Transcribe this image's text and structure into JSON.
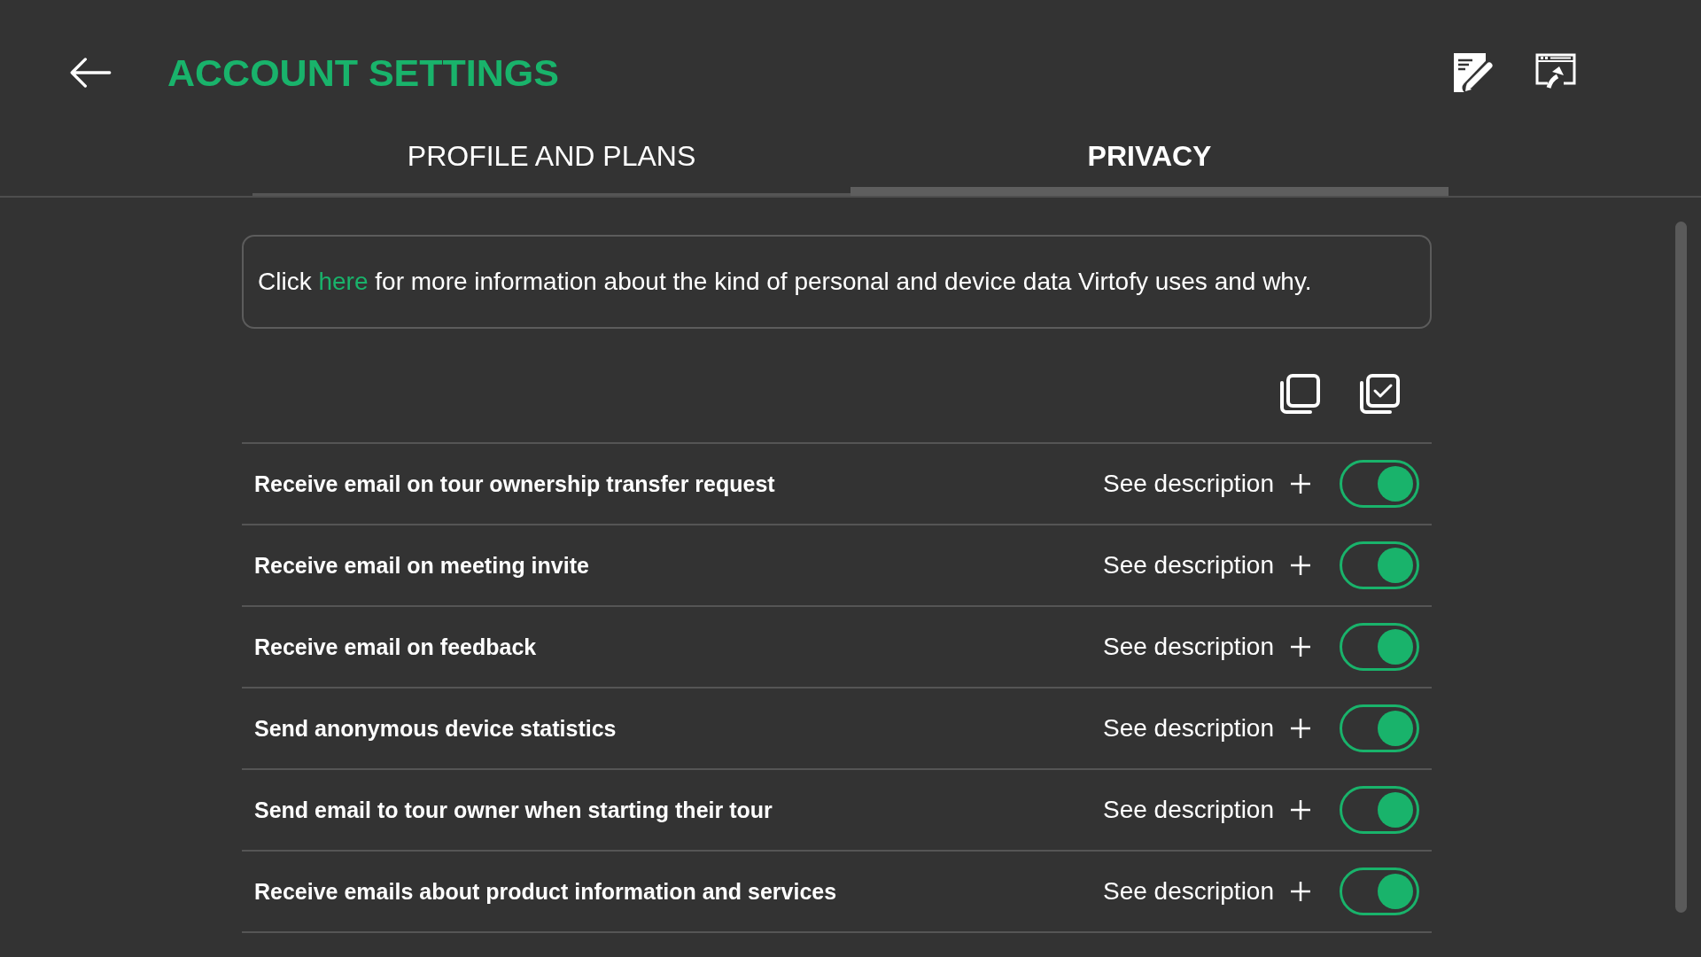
{
  "header": {
    "title": "ACCOUNT SETTINGS"
  },
  "tabs": [
    {
      "label": "PROFILE AND PLANS",
      "selected": false
    },
    {
      "label": "PRIVACY",
      "selected": true
    }
  ],
  "info": {
    "before": "Click",
    "link": "here",
    "after": "for more information about the kind of personal and device data Virtofy uses and why."
  },
  "settings": [
    {
      "label": "Receive email on tour ownership transfer request",
      "action": "See description",
      "on": true
    },
    {
      "label": "Receive email on meeting invite",
      "action": "See description",
      "on": true
    },
    {
      "label": "Receive email on feedback",
      "action": "See description",
      "on": true
    },
    {
      "label": "Send anonymous device statistics",
      "action": "See description",
      "on": true
    },
    {
      "label": "Send email to tour owner when starting their tour",
      "action": "See description",
      "on": true
    },
    {
      "label": "Receive emails about product information and services",
      "action": "See description",
      "on": true
    }
  ]
}
